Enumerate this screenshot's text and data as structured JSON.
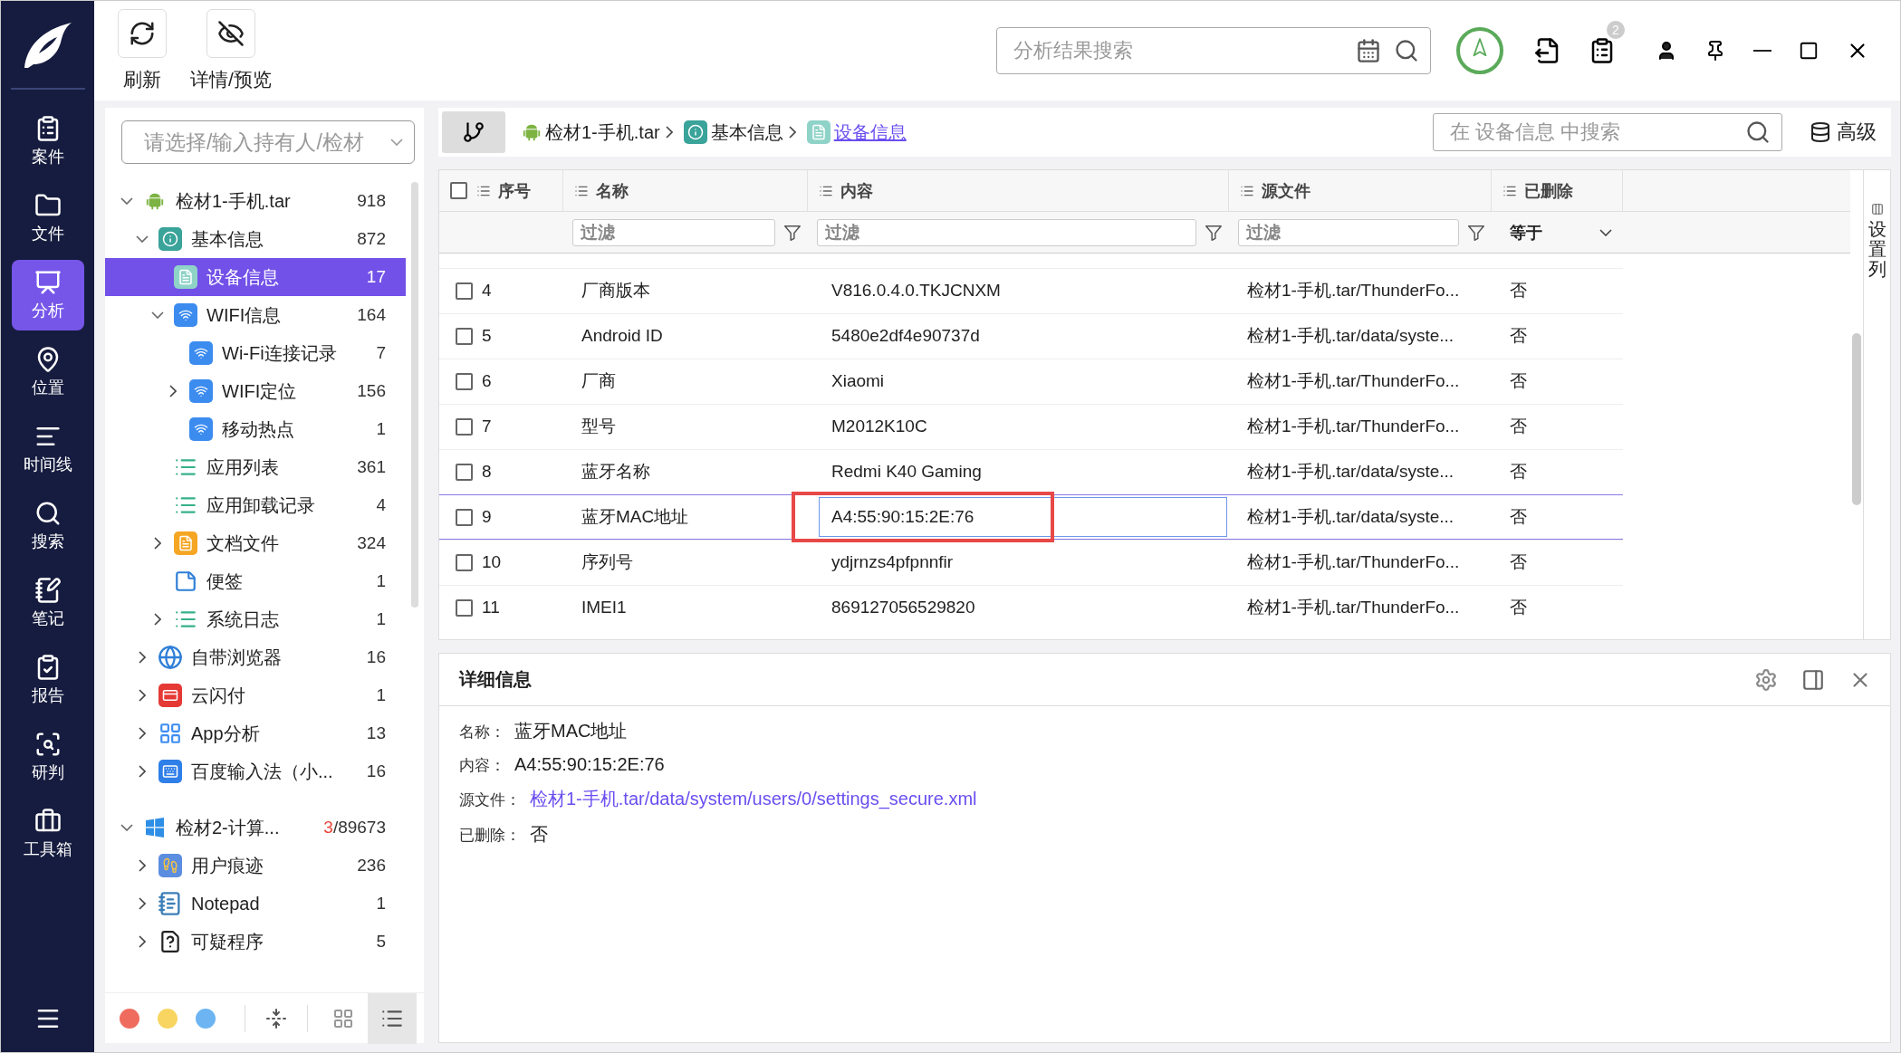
{
  "nav": {
    "items": [
      {
        "label": "案件",
        "selected": false
      },
      {
        "label": "文件",
        "selected": false
      },
      {
        "label": "分析",
        "selected": true
      },
      {
        "label": "位置",
        "selected": false
      },
      {
        "label": "时间线",
        "selected": false
      },
      {
        "label": "搜索",
        "selected": false
      },
      {
        "label": "笔记",
        "selected": false
      },
      {
        "label": "报告",
        "selected": false
      },
      {
        "label": "研判",
        "selected": false
      },
      {
        "label": "工具箱",
        "selected": false
      }
    ]
  },
  "toolbar": {
    "buttons": [
      {
        "kind": "refresh",
        "label": "刷新"
      },
      {
        "kind": "preview",
        "label": "详情/预览"
      }
    ]
  },
  "header": {
    "search": {
      "placeholder": "分析结果搜索"
    },
    "tasks_badge": "2"
  },
  "tree_panel": {
    "owner_select": {
      "placeholder": "请选择/输入持有人/检材"
    },
    "tree": [
      {
        "label": "检材1-手机.tar",
        "count": "918",
        "kind": "android",
        "expanded": true,
        "selected": false,
        "children": [
          {
            "label": "基本信息",
            "count": "872",
            "kind": "info",
            "expanded": true,
            "selected": false,
            "children": [
              {
                "label": "设备信息",
                "count": "17",
                "kind": "doc",
                "selected": true
              },
              {
                "label": "WIFI信息",
                "count": "164",
                "kind": "wifi",
                "expanded": true,
                "selected": false,
                "children": [
                  {
                    "label": "Wi-Fi连接记录",
                    "count": "7",
                    "kind": "wifi",
                    "selected": false
                  },
                  {
                    "label": "WIFI定位",
                    "count": "156",
                    "kind": "wifi",
                    "expanded": false,
                    "selected": false
                  },
                  {
                    "label": "移动热点",
                    "count": "1",
                    "kind": "wifi",
                    "selected": false
                  }
                ]
              },
              {
                "label": "应用列表",
                "count": "361",
                "kind": "list",
                "selected": false
              },
              {
                "label": "应用卸载记录",
                "count": "4",
                "kind": "list",
                "selected": false
              },
              {
                "label": "文档文件",
                "count": "324",
                "kind": "file",
                "expanded": false,
                "selected": false
              },
              {
                "label": "便签",
                "count": "1",
                "kind": "note",
                "selected": false
              },
              {
                "label": "系统日志",
                "count": "1",
                "kind": "list",
                "expanded": false,
                "selected": false
              }
            ]
          },
          {
            "label": "自带浏览器",
            "count": "16",
            "kind": "globe",
            "expanded": false,
            "selected": false
          },
          {
            "label": "云闪付",
            "count": "1",
            "kind": "pay",
            "expanded": false,
            "selected": false
          },
          {
            "label": "App分析",
            "count": "13",
            "kind": "grid",
            "expanded": false,
            "selected": false
          },
          {
            "label": "百度输入法（小...",
            "count": "16",
            "kind": "keyboard",
            "expanded": false,
            "selected": false
          }
        ]
      },
      {
        "label": "检材2-计算...",
        "alert_count": "3",
        "count": "/89673",
        "kind": "windows",
        "expanded": true,
        "selected": false,
        "children": [
          {
            "label": "用户痕迹",
            "count": "236",
            "kind": "footprints",
            "expanded": false,
            "selected": false
          },
          {
            "label": "Notepad",
            "count": "1",
            "kind": "notepad",
            "expanded": false,
            "selected": false
          },
          {
            "label": "可疑程序",
            "count": "5",
            "kind": "suspect",
            "expanded": false,
            "selected": false
          }
        ]
      }
    ],
    "color_tags": [
      {
        "color": "#ef6b5e"
      },
      {
        "color": "#f7d560"
      },
      {
        "color": "#6cb5f2"
      }
    ],
    "view_modes": [
      {
        "kind": "grid",
        "selected": false
      },
      {
        "kind": "list",
        "selected": true
      }
    ]
  },
  "breadcrumb": {
    "items": [
      {
        "label": "检材1-手机.tar",
        "kind": "android",
        "selected": false
      },
      {
        "label": "基本信息",
        "kind": "info",
        "selected": false
      },
      {
        "label": "设备信息",
        "kind": "doc",
        "selected": true
      }
    ],
    "search": {
      "placeholder": "在 设备信息 中搜索"
    },
    "advanced_button": "高级"
  },
  "table": {
    "select_all_checked": false,
    "columns": [
      "序号",
      "名称",
      "内容",
      "源文件",
      "已删除"
    ],
    "filters": [
      {
        "kind": "text",
        "placeholder": "过滤"
      },
      {
        "kind": "text",
        "placeholder": "过滤"
      },
      {
        "kind": "text",
        "placeholder": "过滤"
      },
      {
        "kind": "select",
        "value": "等于"
      }
    ],
    "rows": [
      {
        "index": "4",
        "name": "厂商版本",
        "content": "V816.0.4.0.TKJCNXM",
        "source": "检材1-手机.tar/ThunderFo...",
        "deleted": "否",
        "checked": false,
        "selected": false,
        "marked": false
      },
      {
        "index": "5",
        "name": "Android ID",
        "content": "5480e2df4e90737d",
        "source": "检材1-手机.tar/data/syste...",
        "deleted": "否",
        "checked": false,
        "selected": false,
        "marked": false
      },
      {
        "index": "6",
        "name": "厂商",
        "content": "Xiaomi",
        "source": "检材1-手机.tar/ThunderFo...",
        "deleted": "否",
        "checked": false,
        "selected": false,
        "marked": false
      },
      {
        "index": "7",
        "name": "型号",
        "content": "M2012K10C",
        "source": "检材1-手机.tar/ThunderFo...",
        "deleted": "否",
        "checked": false,
        "selected": false,
        "marked": false
      },
      {
        "index": "8",
        "name": "蓝牙名称",
        "content": "Redmi K40 Gaming",
        "source": "检材1-手机.tar/data/syste...",
        "deleted": "否",
        "checked": false,
        "selected": false,
        "marked": false
      },
      {
        "index": "9",
        "name": "蓝牙MAC地址",
        "content": "A4:55:90:15:2E:76",
        "source": "检材1-手机.tar/data/syste...",
        "deleted": "否",
        "checked": false,
        "selected": true,
        "marked": true
      },
      {
        "index": "10",
        "name": "序列号",
        "content": "ydjrnzs4pfpnnfir",
        "source": "检材1-手机.tar/ThunderFo...",
        "deleted": "否",
        "checked": false,
        "selected": false,
        "marked": false
      },
      {
        "index": "11",
        "name": "IMEI1",
        "content": "869127056529820",
        "source": "检材1-手机.tar/ThunderFo...",
        "deleted": "否",
        "checked": false,
        "selected": false,
        "marked": false
      }
    ],
    "column_settings": "设置列"
  },
  "detail": {
    "title": "详细信息",
    "fields": [
      {
        "label": "名称：",
        "value": "蓝牙MAC地址",
        "kind": "text"
      },
      {
        "label": "内容：",
        "value": "A4:55:90:15:2E:76",
        "kind": "text"
      },
      {
        "label": "源文件：",
        "value": "检材1-手机.tar/data/system/users/0/settings_secure.xml",
        "kind": "link"
      },
      {
        "label": "已删除：",
        "value": "否",
        "kind": "text"
      }
    ]
  }
}
